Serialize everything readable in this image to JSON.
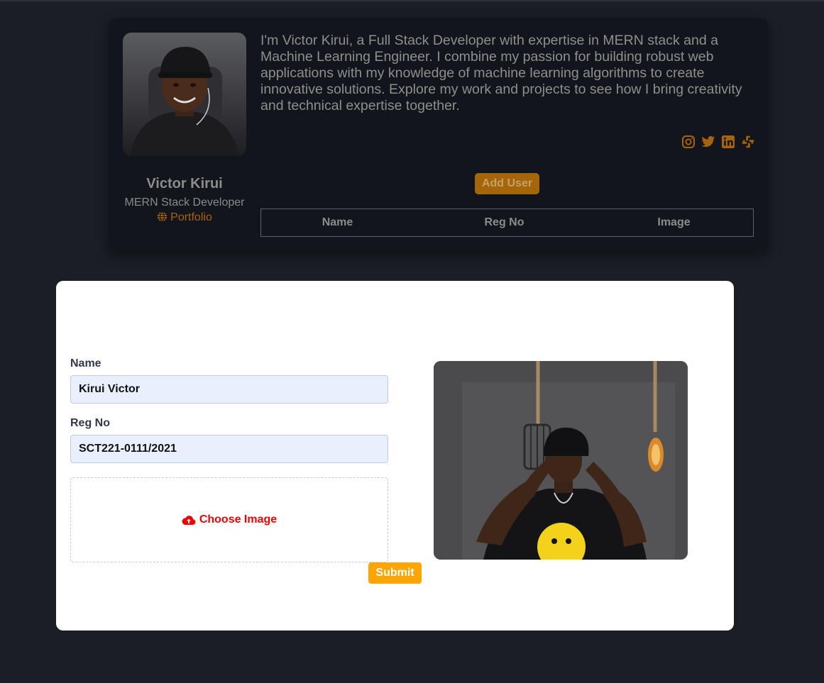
{
  "profile": {
    "name": "Victor Kirui",
    "role": "MERN Stack Developer",
    "portfolio_label": "Portfolio",
    "bio": "I'm Victor Kirui, a Full Stack Developer with expertise in MERN stack and a Machine Learning Engineer. I combine my passion for building robust web applications with my knowledge of machine learning algorithms to create innovative solutions. Explore my work and projects to see how I bring creativity and technical expertise together.",
    "socials": [
      "instagram-icon",
      "twitter-icon",
      "linkedin-icon",
      "slack-icon"
    ],
    "add_user_label": "Add User",
    "table_headers": [
      "Name",
      "Reg No",
      "Image"
    ]
  },
  "form": {
    "name_label": "Name",
    "name_value": "Kirui Victor",
    "regno_label": "Reg No",
    "regno_value": "SCT221-0111/2021",
    "choose_image_label": "Choose Image",
    "submit_label": "Submit"
  },
  "colors": {
    "background": "#1b1e26",
    "card": "#12161c",
    "accent": "#ffa500",
    "accent_dim": "#a4650b",
    "choose_red": "#ee0000"
  }
}
